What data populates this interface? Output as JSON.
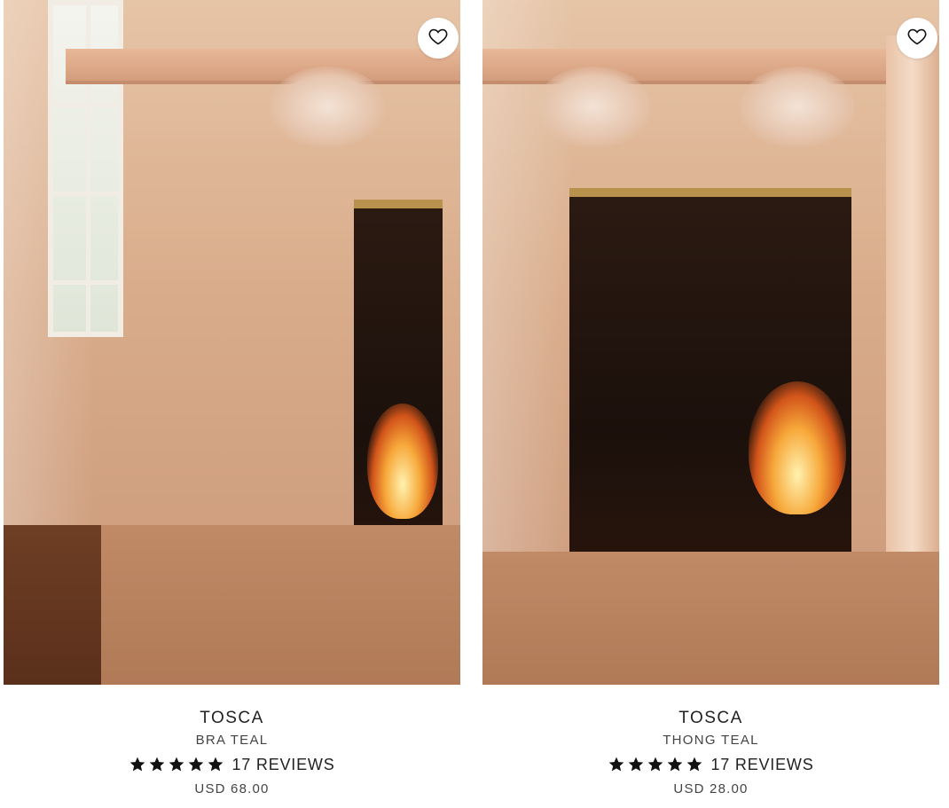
{
  "products": [
    {
      "name": "TOSCA",
      "variant": "BRA TEAL",
      "rating_stars": 5,
      "reviews": "17 REVIEWS",
      "price": "USD 68.00",
      "favorite_icon": "heart-outline-icon"
    },
    {
      "name": "TOSCA",
      "variant": "THONG TEAL",
      "rating_stars": 5,
      "reviews": "17 REVIEWS",
      "price": "USD 28.00",
      "favorite_icon": "heart-outline-icon"
    }
  ],
  "colors": {
    "text": "#222222",
    "star": "#111111",
    "background": "#ffffff"
  }
}
